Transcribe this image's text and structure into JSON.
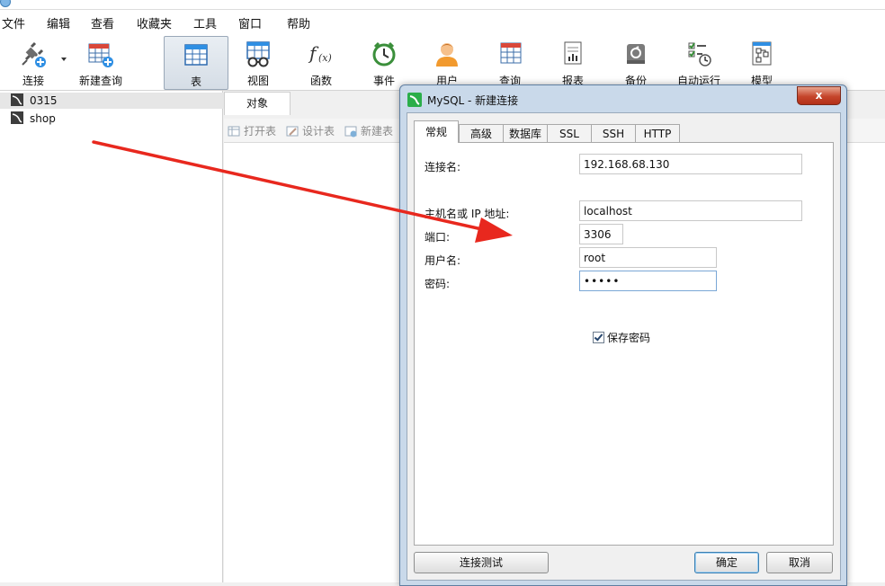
{
  "menubar": {
    "items": [
      "文件",
      "编辑",
      "查看",
      "收藏夹",
      "工具",
      "窗口",
      "帮助"
    ]
  },
  "toolbar": {
    "items": [
      {
        "label": "连接",
        "icon": "plug-connect-icon"
      },
      {
        "label": "新建查询",
        "icon": "new-query-icon"
      },
      {
        "label": "表",
        "icon": "table-icon",
        "active": true
      },
      {
        "label": "视图",
        "icon": "view-glasses-icon"
      },
      {
        "label": "函数",
        "icon": "function-fx-icon"
      },
      {
        "label": "事件",
        "icon": "clock-icon"
      },
      {
        "label": "用户",
        "icon": "user-icon"
      },
      {
        "label": "查询",
        "icon": "query-icon"
      },
      {
        "label": "报表",
        "icon": "report-icon"
      },
      {
        "label": "备份",
        "icon": "backup-icon"
      },
      {
        "label": "自动运行",
        "icon": "schedule-icon"
      },
      {
        "label": "模型",
        "icon": "model-icon"
      }
    ]
  },
  "sidebar": {
    "connections": [
      "0315",
      "shop"
    ]
  },
  "objects": {
    "tab": "对象",
    "buttons": [
      "打开表",
      "设计表",
      "新建表"
    ]
  },
  "dialog": {
    "title": "MySQL - 新建连接",
    "close": "x",
    "tabs": [
      "常规",
      "高级",
      "数据库",
      "SSL",
      "SSH",
      "HTTP"
    ],
    "fields": {
      "connection_name_label": "连接名:",
      "connection_name_value": "192.168.68.130",
      "host_label": "主机名或 IP 地址:",
      "host_value": "localhost",
      "port_label": "端口:",
      "port_value": "3306",
      "user_label": "用户名:",
      "user_value": "root",
      "password_label": "密码:",
      "password_value": "•••••",
      "save_password_label": "保存密码",
      "save_password_checked": true
    },
    "buttons": {
      "test": "连接测试",
      "ok": "确定",
      "cancel": "取消"
    }
  },
  "colors": {
    "arrow": "#e8281e",
    "dialog_frame": "#c9d9ea",
    "close": "#c5452b"
  }
}
